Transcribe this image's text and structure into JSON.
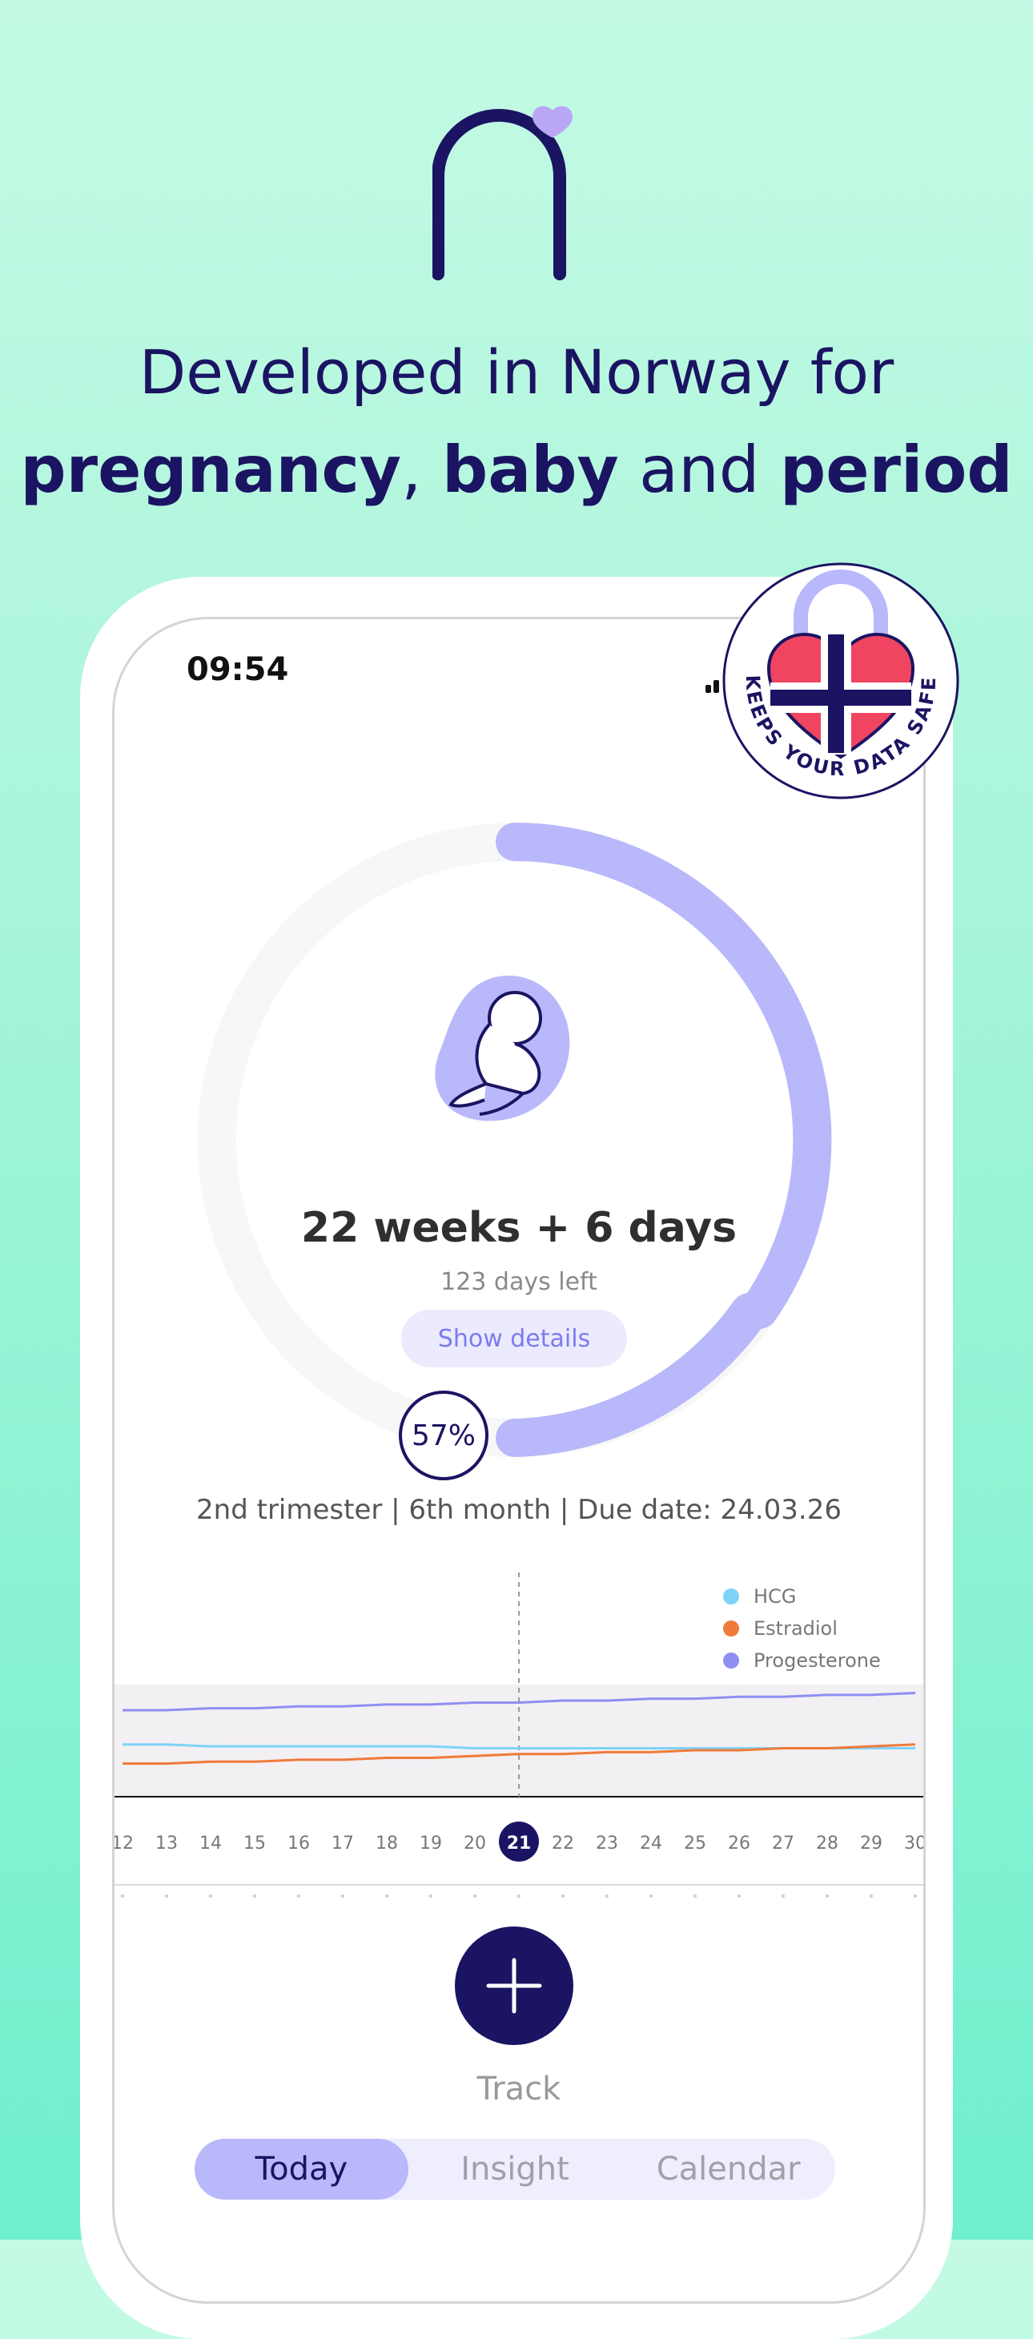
{
  "headline": {
    "line1": "Developed in Norway for",
    "w1": "pregnancy",
    "sep1": ", ",
    "w2": "baby",
    "sep2": " and ",
    "w3": "period"
  },
  "status": {
    "time": "09:54"
  },
  "badge": {
    "text": "KEEPS YOUR DATA SAFE"
  },
  "pregnancy": {
    "weeks_text": "22 weeks + 6 days",
    "days_left": "123 days left",
    "show_details": "Show details",
    "percent_label": "57%",
    "progress": 0.57,
    "trimester_info": "2nd trimester | 6th month | Due date: 24.03.26"
  },
  "chart_data": {
    "type": "line",
    "x": [
      12,
      13,
      14,
      15,
      16,
      17,
      18,
      19,
      20,
      21,
      22,
      23,
      24,
      25,
      26,
      27,
      28,
      29,
      30
    ],
    "selected_x": 21,
    "series": [
      {
        "name": "HCG",
        "color": "#7fd3f7",
        "values": [
          40,
          40,
          39,
          39,
          39,
          39,
          39,
          39,
          38,
          38,
          38,
          38,
          38,
          38,
          38,
          38,
          38,
          38,
          38
        ]
      },
      {
        "name": "Estradiol",
        "color": "#f07a3a",
        "values": [
          30,
          30,
          31,
          31,
          32,
          32,
          33,
          33,
          34,
          35,
          35,
          36,
          36,
          37,
          37,
          38,
          38,
          39,
          40
        ]
      },
      {
        "name": "Progesterone",
        "color": "#8f8ef2",
        "values": [
          58,
          58,
          59,
          59,
          60,
          60,
          61,
          61,
          62,
          62,
          63,
          63,
          64,
          64,
          65,
          65,
          66,
          66,
          67
        ]
      }
    ],
    "ylim": [
      0,
      100
    ]
  },
  "track": {
    "label": "Track"
  },
  "tabs": [
    {
      "label": "Today",
      "active": true
    },
    {
      "label": "Insight",
      "active": false
    },
    {
      "label": "Calendar",
      "active": false
    }
  ],
  "colors": {
    "brand": "#1b1462",
    "accent": "#b9b8fb",
    "bg": "#a8f5da"
  }
}
